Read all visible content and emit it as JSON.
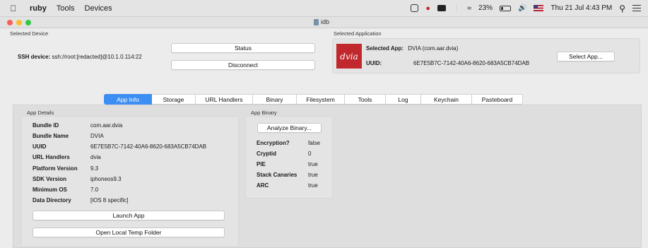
{
  "menubar": {
    "app_name": "ruby",
    "menus": [
      "Tools",
      "Devices"
    ],
    "wifi_battery": "23%",
    "datetime": "Thu 21 Jul  4:43 PM"
  },
  "window": {
    "title": "idb"
  },
  "selected_device": {
    "group_label": "Selected Device",
    "ssh_label": "SSH device:",
    "ssh_value": "ssh://root:[redacted]@10.1.0.114:22",
    "status_button": "Status",
    "disconnect_button": "Disconnect"
  },
  "selected_application": {
    "group_label": "Selected Application",
    "logo_text": "dvia",
    "app_label": "Selected App:",
    "app_value": "DVIA (com.aar.dvia)",
    "uuid_label": "UUID:",
    "uuid_value": "6E7E5B7C-7142-40A6-8620-683A5CB74DAB",
    "select_button": "Select App..."
  },
  "tabs": [
    "App Info",
    "Storage",
    "URL Handlers",
    "Binary",
    "Filesystem",
    "Tools",
    "Log",
    "Keychain",
    "Pasteboard"
  ],
  "app_details": {
    "group_label": "App Details",
    "rows": [
      {
        "label": "Bundle ID",
        "value": "com.aar.dvia"
      },
      {
        "label": "Bundle Name",
        "value": "DVIA"
      },
      {
        "label": "UUID",
        "value": "6E7E5B7C-7142-40A6-8620-683A5CB74DAB"
      },
      {
        "label": "URL Handlers",
        "value": "dvia"
      },
      {
        "label": "Platform Version",
        "value": "9.3"
      },
      {
        "label": "SDK Version",
        "value": "iphoneos9.3"
      },
      {
        "label": "Minimum OS",
        "value": "7.0"
      },
      {
        "label": "Data Directory",
        "value": "[iOS 8 specific]"
      }
    ],
    "launch_button": "Launch App",
    "open_temp_button": "Open Local Temp Folder"
  },
  "app_binary": {
    "group_label": "App Binary",
    "analyze_button": "Analyze Binary...",
    "rows": [
      {
        "label": "Encryption?",
        "value": "false"
      },
      {
        "label": "Cryptid",
        "value": "0"
      },
      {
        "label": "PIE",
        "value": "true"
      },
      {
        "label": "Stack Canaries",
        "value": "true"
      },
      {
        "label": "ARC",
        "value": "true"
      }
    ]
  }
}
